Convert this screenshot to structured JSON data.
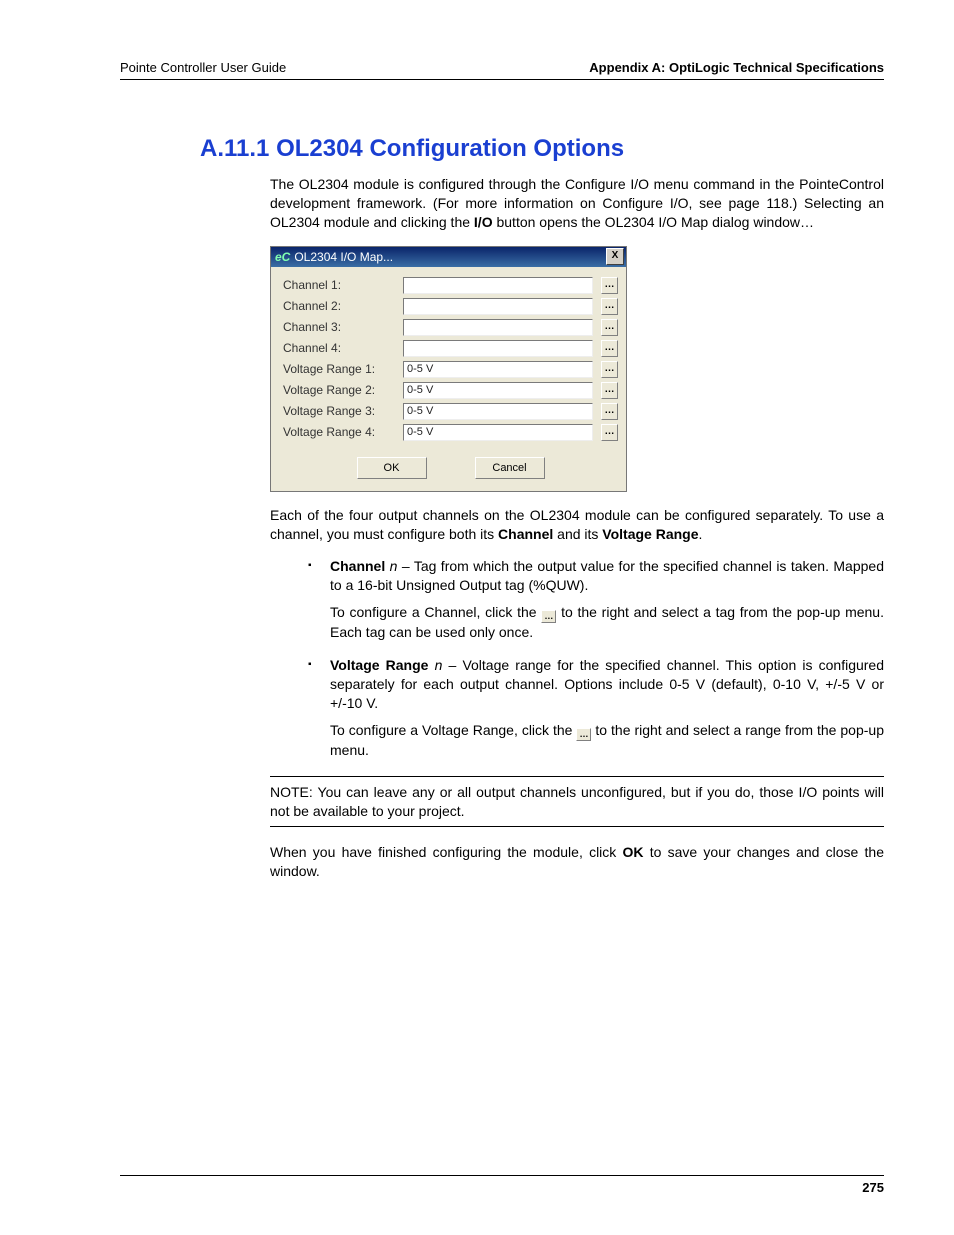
{
  "header": {
    "left": "Pointe Controller User Guide",
    "right": "Appendix A: OptiLogic Technical Specifications"
  },
  "section_number": "A.11.1",
  "section_title": "OL2304 Configuration Options",
  "intro": "The OL2304 module is configured through the Configure I/O menu command in the PointeControl development framework. (For more information on Configure I/O, see page 118.) Selecting an OL2304 module and clicking the ",
  "intro_bold": "I/O",
  "intro_tail": " button opens the OL2304 I/O Map dialog window…",
  "dialog": {
    "title": "OL2304 I/O Map...",
    "icon": "eC",
    "close": "X",
    "rows": [
      {
        "label": "Channel 1:",
        "value": ""
      },
      {
        "label": "Channel 2:",
        "value": ""
      },
      {
        "label": "Channel 3:",
        "value": ""
      },
      {
        "label": "Channel 4:",
        "value": ""
      },
      {
        "label": "Voltage Range 1:",
        "value": "0-5 V"
      },
      {
        "label": "Voltage Range 2:",
        "value": "0-5 V"
      },
      {
        "label": "Voltage Range 3:",
        "value": "0-5 V"
      },
      {
        "label": "Voltage Range 4:",
        "value": "0-5 V"
      }
    ],
    "ok": "OK",
    "cancel": "Cancel",
    "dots": "…"
  },
  "para2_a": "Each of the four output channels on the OL2304 module can be configured separately. To use a channel, you must configure both its ",
  "para2_b1": "Channel",
  "para2_mid": " and its ",
  "para2_b2": "Voltage Range",
  "para2_end": ".",
  "bullet1": {
    "bold": "Channel",
    "ital": "n",
    "text": " – Tag from which the output value for the specified channel is taken. Mapped to a 16-bit Unsigned Output tag (%QUW).",
    "extra_a": "To configure a Channel, click the ",
    "extra_b": " to the right and select a tag from the pop-up menu. Each tag can be used only once."
  },
  "bullet2": {
    "bold": "Voltage Range",
    "ital": "n",
    "text": " – Voltage range for the specified channel. This option is configured separately for each output channel. Options include 0-5 V (default), 0-10 V, +/-5 V or +/-10 V.",
    "extra_a": "To configure a Voltage Range, click the ",
    "extra_b": " to the right and select a range from the pop-up menu."
  },
  "note": "NOTE: You can leave any or all output channels unconfigured, but if you do, those I/O points will not be available to your project.",
  "closing_a": "When you have finished configuring the module, click ",
  "closing_b": "OK",
  "closing_c": " to save your changes and close the window.",
  "page_number": "275",
  "inline_btn": "…"
}
